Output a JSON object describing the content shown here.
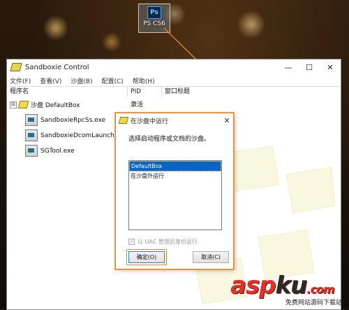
{
  "desktop": {
    "shortcut_label": "PS CS6",
    "shortcut_logo": "Ps"
  },
  "window": {
    "title": "Sandboxie Control",
    "controls": {
      "minimize": "—",
      "maximize": "☐",
      "close": "✕"
    },
    "menu": [
      "文件(F)",
      "查看(V)",
      "沙盘(B)",
      "配置(C)",
      "帮助(H)"
    ],
    "columns": [
      "程序名",
      "PID",
      "窗口标题"
    ],
    "tree": {
      "toggle": "⊟",
      "sandbox_label": "沙盘 DefaultBox",
      "sandbox_status": "激活",
      "processes": [
        "SandboxieRpcSs.exe",
        "SandboxieDcomLaunch.exe",
        "SGTool.exe"
      ]
    }
  },
  "dialog": {
    "title": "在沙盘中运行",
    "close": "✕",
    "prompt": "选择启动程序或文档的沙盘。",
    "options": [
      "DefaultBox",
      "在沙盘外运行"
    ],
    "selected_index": 0,
    "admin_checkbox_label": "以 UAC 管理员身份运行",
    "admin_checkbox_checked": "✓",
    "ok_label": "确定(O)",
    "cancel_label": "取消(C)"
  },
  "watermark": {
    "brand_a": "asp",
    "brand_b": "ku",
    "brand_c": ".com",
    "tagline": "免费网站源码下载站！"
  }
}
